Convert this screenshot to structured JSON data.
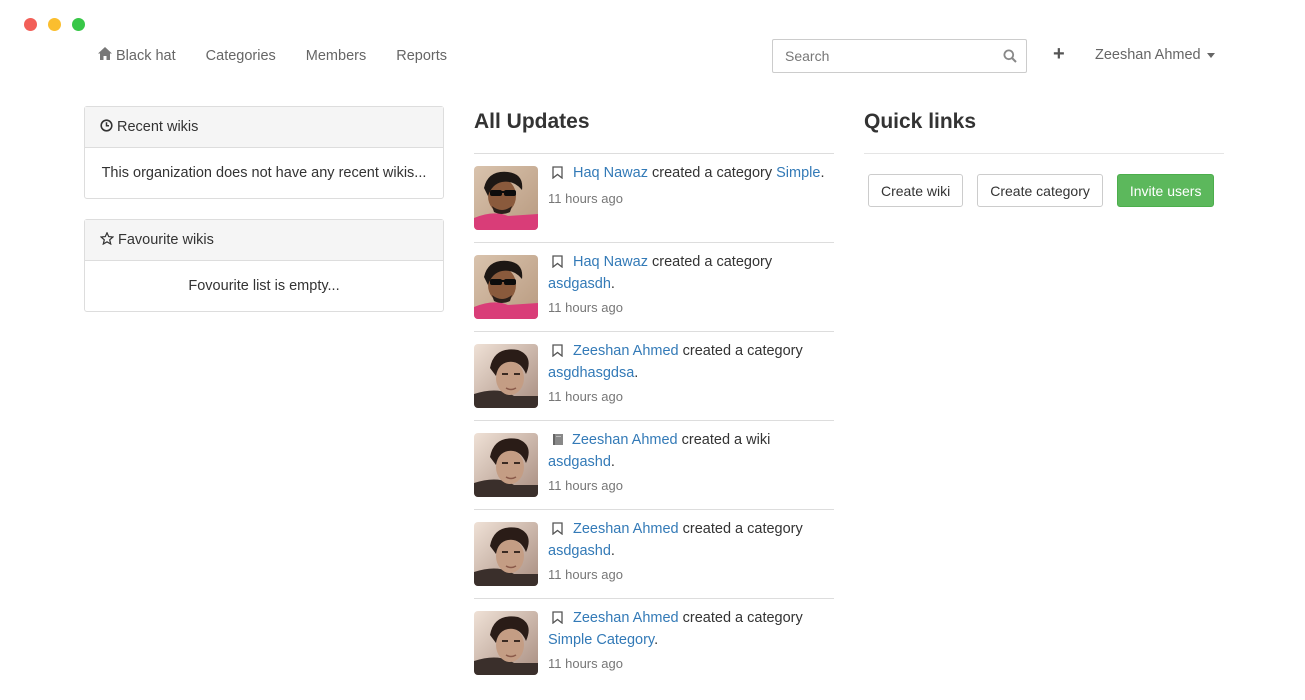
{
  "nav": {
    "brand": "Black hat",
    "links": [
      "Categories",
      "Members",
      "Reports"
    ],
    "search_placeholder": "Search",
    "user": "Zeeshan Ahmed"
  },
  "recent": {
    "title": "Recent wikis",
    "empty": "This organization does not have any recent wikis..."
  },
  "favourite": {
    "title": "Favourite wikis",
    "empty": "Fovourite list is empty..."
  },
  "updates": {
    "title": "All Updates",
    "items": [
      {
        "user": "Haq Nawaz",
        "action": "created a category",
        "target": "Simple",
        "time": "11 hours ago",
        "icon": "bookmark-icon"
      },
      {
        "user": "Haq Nawaz",
        "action": "created a category",
        "target": "asdgasdh",
        "time": "11 hours ago",
        "icon": "bookmark-icon"
      },
      {
        "user": "Zeeshan Ahmed",
        "action": "created a category",
        "target": "asgdhasgdsa",
        "time": "11 hours ago",
        "icon": "bookmark-icon"
      },
      {
        "user": "Zeeshan Ahmed",
        "action": "created a wiki",
        "target": "asdgashd",
        "time": "11 hours ago",
        "icon": "book-icon"
      },
      {
        "user": "Zeeshan Ahmed",
        "action": "created a category",
        "target": "asdgashd",
        "time": "11 hours ago",
        "icon": "bookmark-icon"
      },
      {
        "user": "Zeeshan Ahmed",
        "action": "created a category",
        "target": "Simple Category",
        "time": "11 hours ago",
        "icon": "bookmark-icon"
      }
    ]
  },
  "quick_links": {
    "title": "Quick links",
    "create_wiki": "Create wiki",
    "create_category": "Create category",
    "invite_users": "Invite users"
  },
  "colors": {
    "link": "#337ab7",
    "success": "#5cb85c"
  }
}
